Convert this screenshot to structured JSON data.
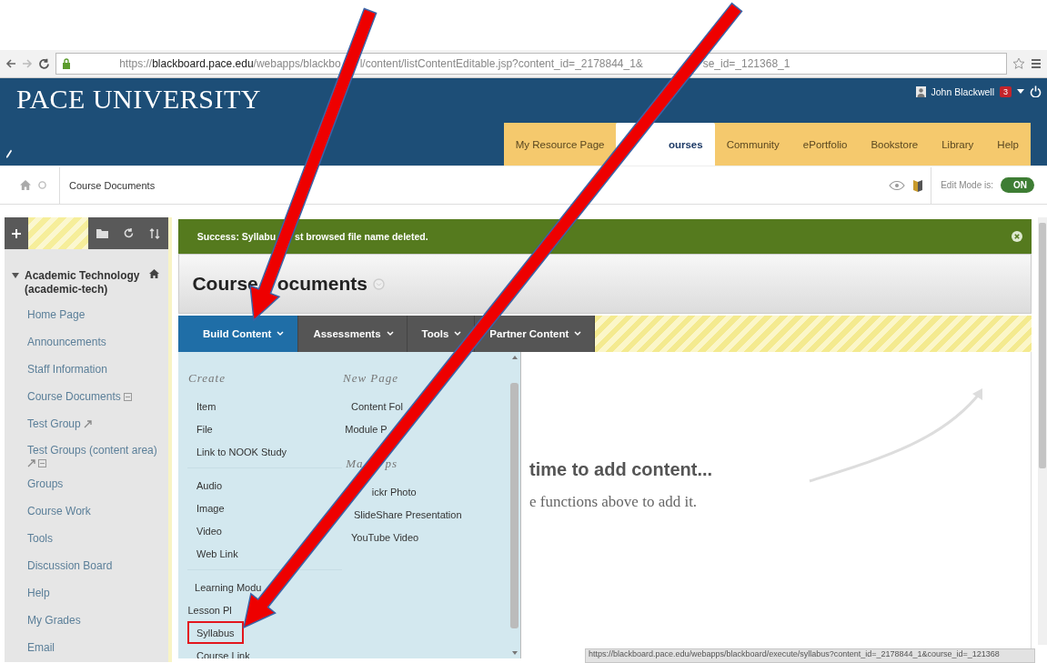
{
  "browser": {
    "url_parts": [
      "https://**blackboard.pace.edu**/webapps/blackbo",
      "l/content/listContentEditable.jsp?content_id=_2178844_1&",
      "se_id=_121368_1"
    ]
  },
  "header": {
    "logo": "PACE UNIVERSITY",
    "user": "John Blackwell",
    "notifications": "3"
  },
  "tabs": [
    {
      "label": "My Resource Page",
      "selected": false
    },
    {
      "label": "ourses",
      "selected": true
    },
    {
      "label": "Community",
      "selected": false
    },
    {
      "label": "ePortfolio",
      "selected": false
    },
    {
      "label": "Bookstore",
      "selected": false
    },
    {
      "label": "Library",
      "selected": false
    },
    {
      "label": "Help",
      "selected": false
    }
  ],
  "breadcrumb": {
    "label": "Course Documents",
    "edit_mode_label": "Edit Mode is:",
    "edit_mode": {
      "label": "ON",
      "on": true
    }
  },
  "sidebar": {
    "course": {
      "title": "Academic Technology (academic-tech)",
      "expanded": true
    },
    "items": [
      {
        "label": "Home Page"
      },
      {
        "label": "Announcements"
      },
      {
        "label": "Staff Information"
      },
      {
        "label": "Course Documents",
        "hidden": true
      },
      {
        "label": "Test Group",
        "linked": true
      },
      {
        "label": "Test Groups (content area)",
        "linked": true,
        "hidden": true
      },
      {
        "label": "Groups"
      },
      {
        "label": "Course Work"
      },
      {
        "label": "Tools"
      },
      {
        "label": "Discussion Board"
      },
      {
        "label": "Help"
      },
      {
        "label": "My Grades"
      },
      {
        "label": "Email"
      }
    ]
  },
  "alert": {
    "kind": "success",
    "message_parts": [
      "Success: Syllabu",
      "st browsed file name deleted."
    ]
  },
  "page_title_parts": [
    "Course",
    "ocuments"
  ],
  "action_bar": [
    {
      "label": "Build Content",
      "selected": true
    },
    {
      "label": "Assessments",
      "selected": false
    },
    {
      "label": "Tools",
      "selected": false
    },
    {
      "label": "Partner Content",
      "selected": false
    }
  ],
  "menu": {
    "columns": [
      {
        "sections": [
          {
            "heading_parts": [
              "Create"
            ],
            "groups": [
              [
                {
                  "label": "Item",
                  "highlighted": false
                },
                {
                  "label": "File",
                  "highlighted": false
                },
                {
                  "label": "Link to NOOK Study",
                  "highlighted": false
                }
              ],
              [
                {
                  "label": "Audio",
                  "highlighted": false
                },
                {
                  "label": "Image",
                  "highlighted": false
                },
                {
                  "label": "Video",
                  "highlighted": false
                },
                {
                  "label": "Web Link",
                  "highlighted": false
                }
              ],
              [
                {
                  "label": "Learning Modu",
                  "highlighted": false
                },
                {
                  "label": "Lesson Pl",
                  "highlighted": false
                },
                {
                  "label": "Syllabus",
                  "highlighted": true
                },
                {
                  "label": "Course Link",
                  "highlighted": false
                }
              ]
            ]
          }
        ]
      },
      {
        "sections": [
          {
            "heading_parts": [
              "New Page"
            ],
            "groups": [
              [
                {
                  "label": "Content Fol",
                  "highlighted": false
                },
                {
                  "label": "Module P",
                  "highlighted": false
                }
              ]
            ]
          },
          {
            "heading_parts": [
              "Ma",
              "ps"
            ],
            "groups": [
              [
                {
                  "label": "ickr Photo",
                  "highlighted": false
                },
                {
                  "label": "SlideShare Presentation",
                  "highlighted": false
                },
                {
                  "label": "YouTube Video",
                  "highlighted": false
                }
              ]
            ]
          }
        ]
      }
    ]
  },
  "empty_state": {
    "heading": "time to add content...",
    "text": "e functions above to add it."
  },
  "status_url": "https://blackboard.pace.edu/webapps/blackboard/execute/syllabus?content_id=_2178844_1&course_id=_121368",
  "annotations": [
    {
      "kind": "arrow"
    },
    {
      "kind": "arrow"
    }
  ]
}
